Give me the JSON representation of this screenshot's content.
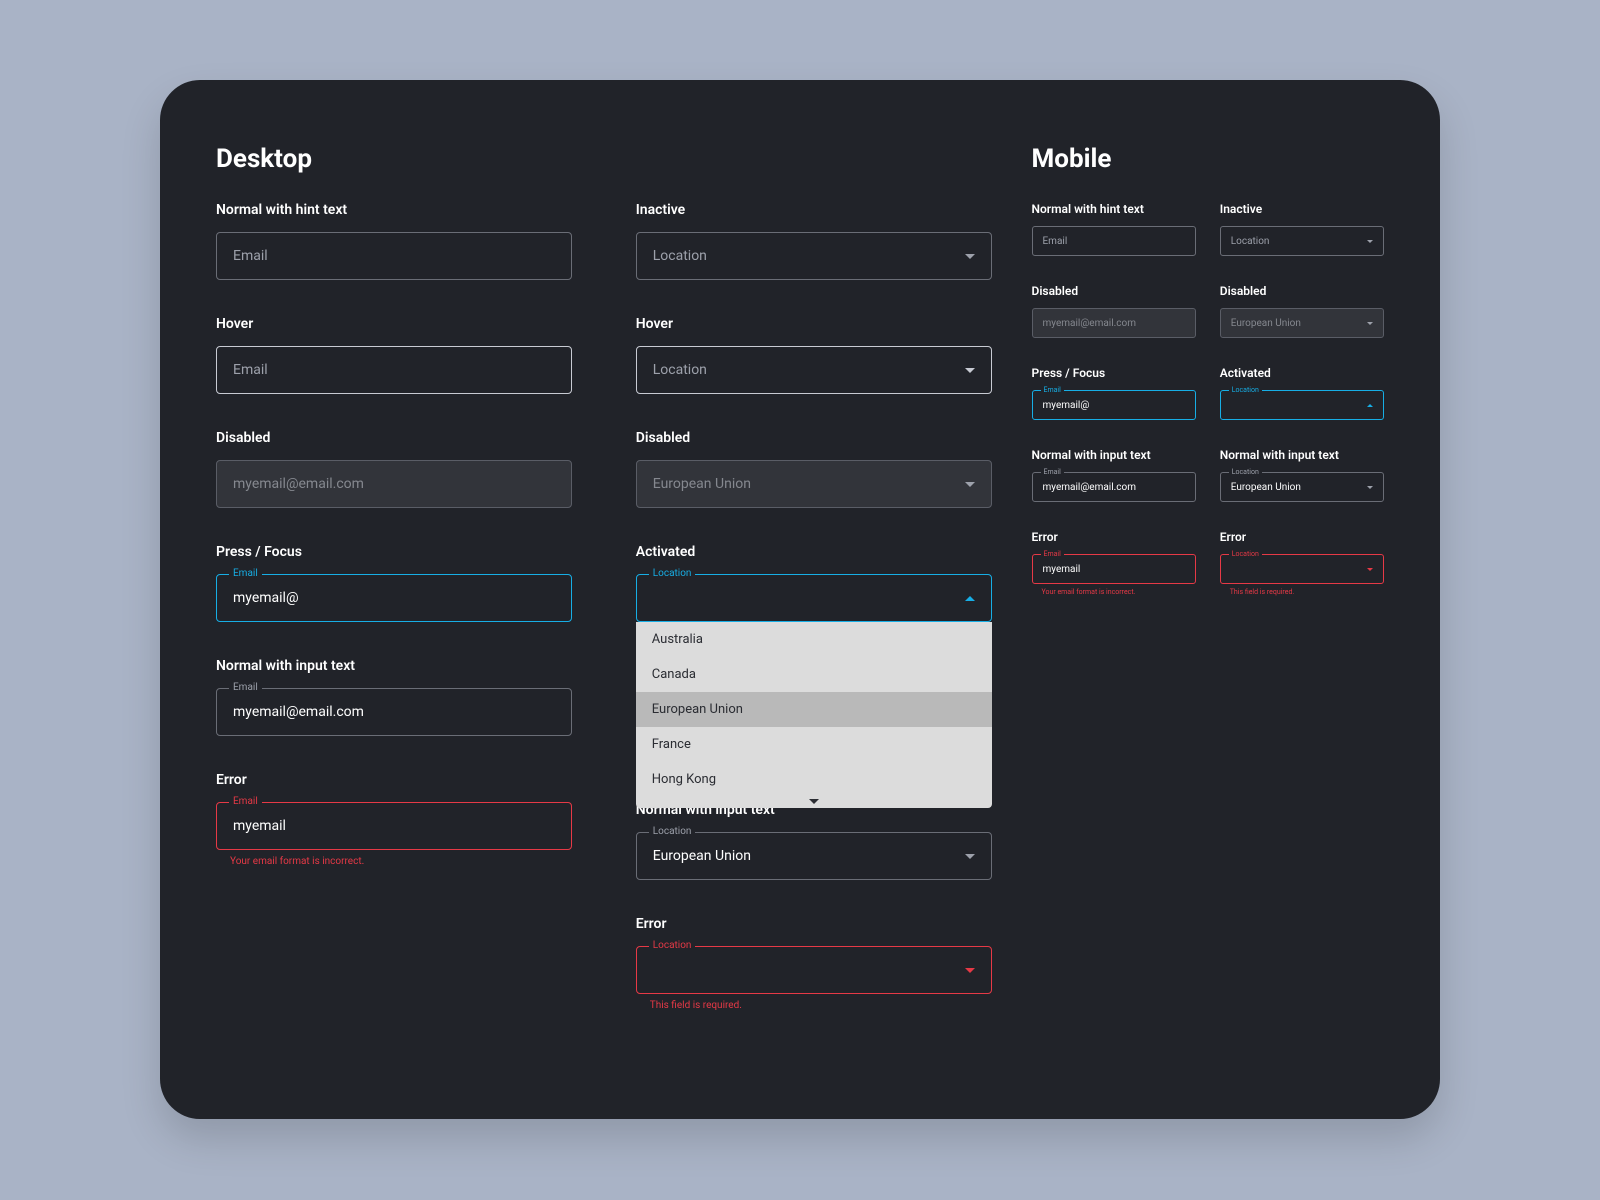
{
  "sections": {
    "desktop_title": "Desktop",
    "mobile_title": "Mobile"
  },
  "states": {
    "normal_hint": "Normal with hint text",
    "hover": "Hover",
    "disabled": "Disabled",
    "press_focus": "Press / Focus",
    "normal_input": "Normal with input text",
    "error": "Error",
    "inactive": "Inactive",
    "activated": "Activated"
  },
  "labels": {
    "email": "Email",
    "location": "Location"
  },
  "placeholders": {
    "email": "Email",
    "location": "Location"
  },
  "values": {
    "email_full": "myemail@email.com",
    "email_partial": "myemail@",
    "email_bad": "myemail",
    "location_eu": "European Union"
  },
  "messages": {
    "email_error": "Your email format is incorrect.",
    "required": "This field is required."
  },
  "dropdown_options": [
    "Australia",
    "Canada",
    "European Union",
    "France",
    "Hong Kong"
  ]
}
